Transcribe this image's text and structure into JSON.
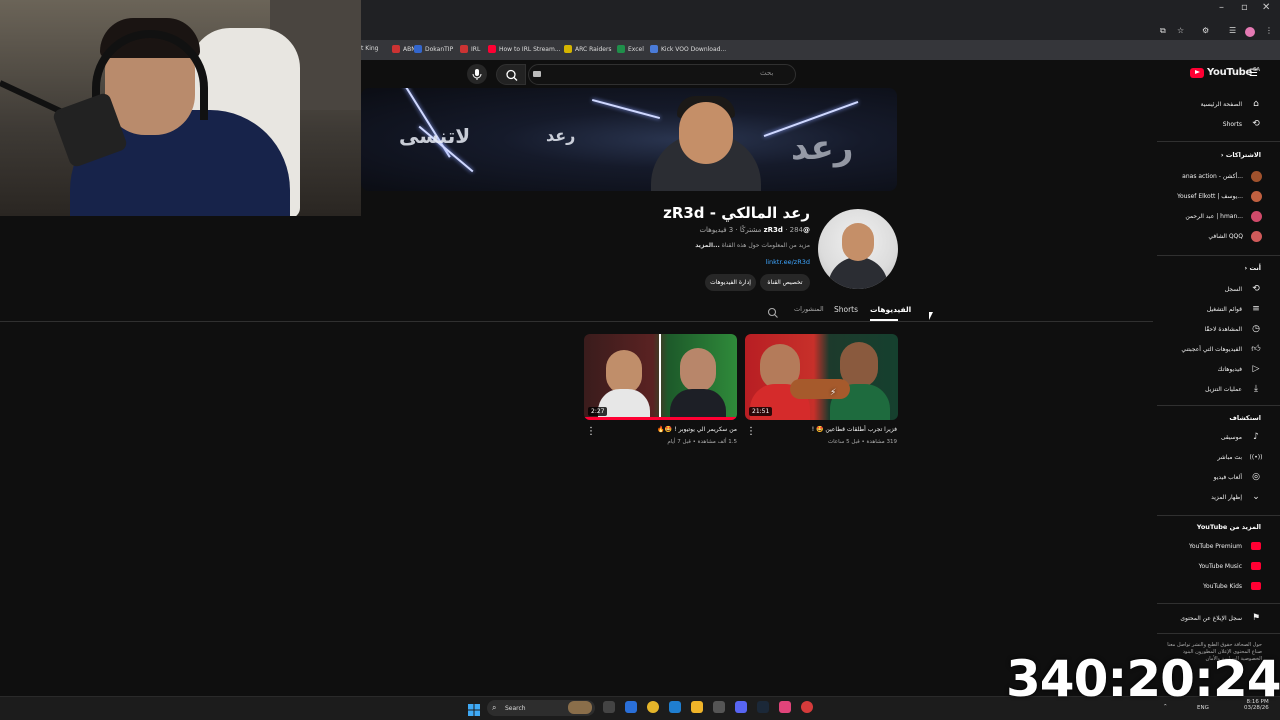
{
  "browser": {
    "bookmarks": [
      {
        "label": "t King",
        "color": "#555555"
      },
      {
        "label": "ABN",
        "color": "#cc3333"
      },
      {
        "label": "DokanTIP",
        "color": "#3366cc"
      },
      {
        "label": "IRL",
        "color": "#cc3333"
      },
      {
        "label": "How to IRL Stream...",
        "color": "#ff0033"
      },
      {
        "label": "ARC Raiders",
        "color": "#d4b400"
      },
      {
        "label": "Excel",
        "color": "#1f8f4a"
      },
      {
        "label": "Kick VOO Download...",
        "color": "#4a7bd8"
      }
    ]
  },
  "masthead": {
    "logo_text": "YouTube",
    "region": "SA",
    "search_placeholder": "بحث"
  },
  "channel": {
    "name": "رعد المالكي - zR3d",
    "handle": "@zR3d",
    "stats": "· 284 مشتركًا · 3 فيديوهات",
    "description": "مزيد من المعلومات حول هذه القناة",
    "more": "...المزيد",
    "link": "linktr.ee/zR3d",
    "buttons": {
      "customize": "تخصيص القناة",
      "manage": "إدارة الفيديوهات"
    },
    "tabs": {
      "videos": "الفيديوهات",
      "shorts": "Shorts",
      "posts": "المنشورات"
    }
  },
  "videos": [
    {
      "title": "فزيرا تجرب أطلقات قطاعين 🤩 !",
      "meta": "319 مشاهدة • قبل 5 ساعات",
      "duration": "21:51"
    },
    {
      "title": "من سكريمر الي يوتيوبر ! 🤩🔥",
      "meta": "1.5 ألف مشاهدة • قبل 7 أيام",
      "duration": "2:27"
    }
  ],
  "sidebar": {
    "main": [
      {
        "label": "الصفحة الرئيسية",
        "icon": "home-icon"
      },
      {
        "label": "Shorts",
        "icon": "shorts-icon"
      }
    ],
    "subscriptions_title": "الاشتراكات",
    "subscriptions": [
      {
        "label": "anas action - أكشن...",
        "color": "#a0522d"
      },
      {
        "label": "Yousef Elkott | يوسف...",
        "color": "#c06040"
      },
      {
        "label": "عبد الرحمن | hman...",
        "color": "#d04a6a"
      },
      {
        "label": "الشافي QQQ",
        "color": "#d05a5a"
      }
    ],
    "you_title": "أنت",
    "you": [
      {
        "label": "السجل",
        "icon": "history-icon"
      },
      {
        "label": "قوائم التشغيل",
        "icon": "playlist-icon"
      },
      {
        "label": "المشاهدة لاحقًا",
        "icon": "clock-icon"
      },
      {
        "label": "الفيديوهات التي أعجبتني",
        "icon": "like-icon"
      },
      {
        "label": "فيديوهاتك",
        "icon": "your-videos-icon"
      },
      {
        "label": "عمليات التنزيل",
        "icon": "download-icon"
      }
    ],
    "explore_title": "استكشاف",
    "explore": [
      {
        "label": "موسيقى",
        "icon": "music-icon"
      },
      {
        "label": "بث مباشر",
        "icon": "live-icon"
      },
      {
        "label": "ألعاب فيديو",
        "icon": "gaming-icon"
      },
      {
        "label": "إظهار المزيد",
        "icon": "chevron-down-icon"
      }
    ],
    "more_title": "المزيد من YouTube",
    "more": [
      {
        "label": "YouTube Premium",
        "color": "#ff0033"
      },
      {
        "label": "YouTube Music",
        "color": "#ff0033"
      },
      {
        "label": "YouTube Kids",
        "color": "#ff0033"
      }
    ],
    "report": "سجل الإبلاغ عن المحتوى",
    "footer": "حول الصحافة حقوق الطبع والنشر تواصل معنا صناع المحتوى الإعلان المطورون البنود الخصوصية السياسة والأمان"
  },
  "timer": "340:20:24",
  "taskbar": {
    "search": "Search",
    "lang": "ENG",
    "time": "8:16 PM",
    "date": "03/28/26"
  },
  "colors": {
    "accent": "#ff0033",
    "link": "#3ea6ff",
    "background": "#0f0f0f"
  }
}
